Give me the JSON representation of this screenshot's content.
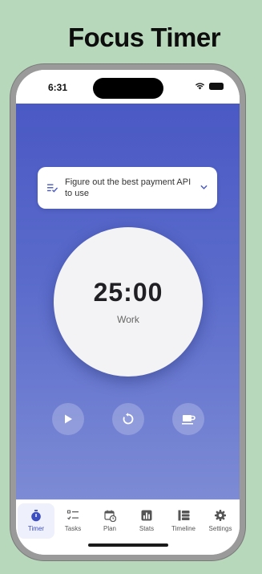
{
  "header": {
    "title": "Focus Timer"
  },
  "status_bar": {
    "time": "6:31"
  },
  "task_selector": {
    "text": "Figure out the best payment API to use"
  },
  "timer": {
    "time": "25:00",
    "mode": "Work"
  },
  "controls": {
    "icons": [
      "play-icon",
      "reset-icon",
      "coffee-icon"
    ]
  },
  "tabs": [
    {
      "label": "Timer",
      "icon": "stopwatch-icon",
      "active": true
    },
    {
      "label": "Tasks",
      "icon": "checklist-icon",
      "active": false
    },
    {
      "label": "Plan",
      "icon": "calendar-clock-icon",
      "active": false
    },
    {
      "label": "Stats",
      "icon": "bar-chart-icon",
      "active": false
    },
    {
      "label": "Timeline",
      "icon": "timeline-icon",
      "active": false
    },
    {
      "label": "Settings",
      "icon": "gear-icon",
      "active": false
    }
  ],
  "colors": {
    "background": "#b8d8bc",
    "gradient_top": "#4a59c4",
    "gradient_bottom": "#7d8bd5",
    "accent": "#3d4fbf"
  }
}
